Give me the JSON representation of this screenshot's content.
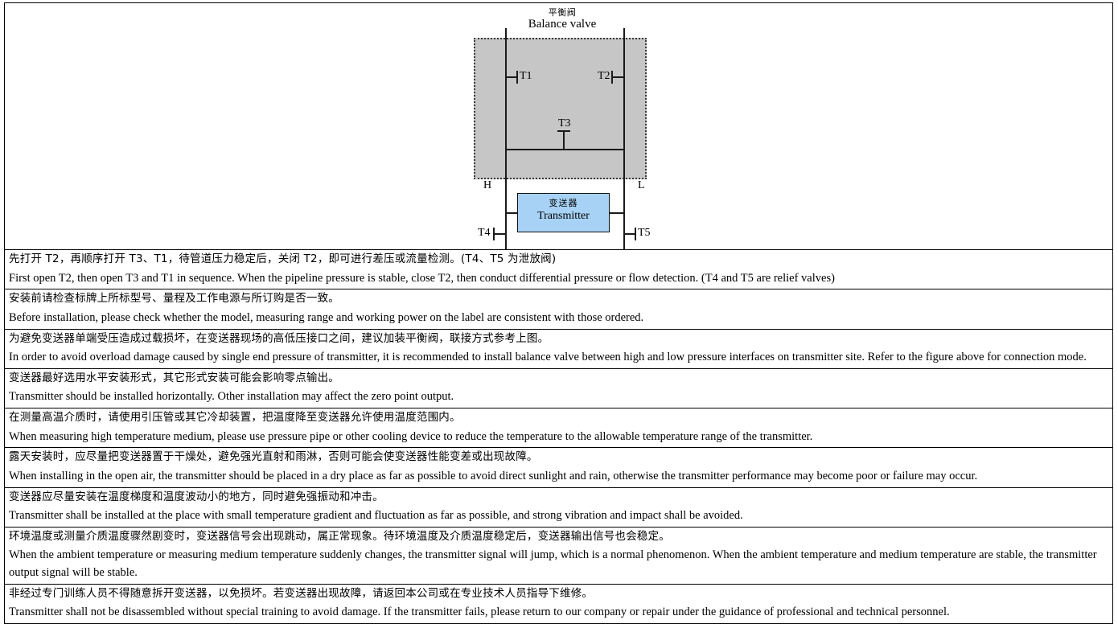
{
  "diagram": {
    "title_cn": "平衡阀",
    "title_en": "Balance valve",
    "transmitter_cn": "变送器",
    "transmitter_en": "Transmitter",
    "valves": {
      "t1": "T1",
      "t2": "T2",
      "t3": "T3",
      "t4": "T4",
      "t5": "T5"
    },
    "ports": {
      "high": "H",
      "low": "L"
    },
    "colors": {
      "process_zone_fill": "#c6c6c6",
      "transmitter_fill": "#a7d2f5",
      "line": "#1a1a1a"
    }
  },
  "notes": [
    {
      "cn": "先打开 T2，再顺序打开 T3、T1，待管道压力稳定后，关闭 T2，即可进行差压或流量检测。(T4、T5 为泄放阀)",
      "en": "First open T2, then open T3 and T1 in sequence. When the pipeline pressure is stable, close T2, then conduct differential pressure or flow detection. (T4 and T5 are relief valves)"
    },
    {
      "cn": "安装前请检查标牌上所标型号、量程及工作电源与所订购是否一致。",
      "en": "Before installation, please check whether the model, measuring range and working power on the label are consistent with those ordered."
    },
    {
      "cn": "为避免变送器单端受压造成过载损坏，在变送器现场的高低压接口之间，建议加装平衡阀，联接方式参考上图。",
      "en": "In order to avoid overload damage caused by single end pressure of transmitter, it is recommended to install balance valve between high and low pressure interfaces on transmitter site. Refer to the figure above for connection mode."
    },
    {
      "cn": "变送器最好选用水平安装形式，其它形式安装可能会影响零点输出。",
      "en": "Transmitter should be installed horizontally. Other installation may affect the zero point output."
    },
    {
      "cn": "在测量高温介质时，请使用引压管或其它冷却装置，把温度降至变送器允许使用温度范围内。",
      "en": "When measuring high temperature medium, please use pressure pipe or other cooling device to reduce the temperature to the allowable temperature range of the transmitter."
    },
    {
      "cn": "露天安装时，应尽量把变送器置于干燥处，避免强光直射和雨淋，否则可能会使变送器性能变差或出现故障。",
      "en": "When installing in the open air, the transmitter should be placed in a dry place as far as possible to avoid direct sunlight and rain, otherwise the transmitter performance may become poor or failure may occur."
    },
    {
      "cn": "变送器应尽量安装在温度梯度和温度波动小的地方，同时避免强振动和冲击。",
      "en": "Transmitter shall be installed at the place with small temperature gradient and fluctuation as far as possible,  and strong vibration and impact shall be avoided."
    },
    {
      "cn": "环境温度或测量介质温度骤然剧变时，变送器信号会出现跳动，属正常现象。待环境温度及介质温度稳定后，变送器输出信号也会稳定。",
      "en": "When the ambient temperature or measuring medium temperature suddenly changes, the transmitter signal will jump, which is a normal phenomenon. When the ambient temperature and medium temperature are stable, the transmitter output signal will be stable."
    },
    {
      "cn": "非经过专门训练人员不得随意拆开变送器，以免损坏。若变送器出现故障，请返回本公司或在专业技术人员指导下维修。",
      "en": "Transmitter shall not be disassembled without special training to avoid damage. If the transmitter fails, please return to our company or repair under the guidance of professional and technical personnel."
    }
  ]
}
